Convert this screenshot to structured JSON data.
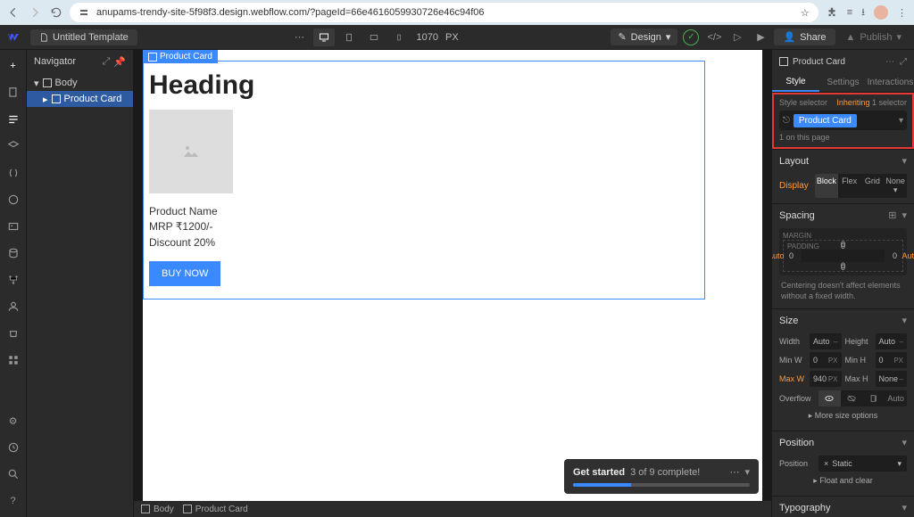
{
  "browser": {
    "url": "anupams-trendy-site-5f98f3.design.webflow.com/?pageId=66e4616059930726e46c94f06"
  },
  "appbar": {
    "doc_title": "Untitled Template",
    "breakpoint_width": "1070",
    "breakpoint_unit": "PX",
    "design_label": "Design",
    "share_label": "Share",
    "publish_label": "Publish"
  },
  "navigator": {
    "title": "Navigator",
    "items": [
      {
        "label": "Body"
      },
      {
        "label": "Product Card"
      }
    ]
  },
  "canvas": {
    "badge": "Product Card",
    "heading": "Heading",
    "lines": {
      "name": "Product Name",
      "mrp": "MRP ₹1200/-",
      "discount": "Discount 20%"
    },
    "buy": "BUY NOW"
  },
  "breadcrumbs": {
    "body": "Body",
    "card": "Product Card"
  },
  "toast": {
    "title": "Get started",
    "progress": "3 of 9 complete!",
    "percent": 33
  },
  "style": {
    "element": "Product Card",
    "tabs": {
      "style": "Style",
      "settings": "Settings",
      "interactions": "Interactions"
    },
    "selector": {
      "label": "Style selector",
      "inheriting": "Inheriting",
      "inherit_count": "1 selector",
      "class": "Product Card",
      "count": "1 on this page"
    },
    "layout": {
      "title": "Layout",
      "display": "Display",
      "opts": {
        "block": "Block",
        "flex": "Flex",
        "grid": "Grid",
        "none": "None"
      }
    },
    "spacing": {
      "title": "Spacing",
      "margin_label": "MARGIN",
      "padding_label": "PADDING",
      "top": "0",
      "right": "Auto",
      "bottom": "0",
      "left": "Auto",
      "p_top": "0",
      "p_right": "0",
      "p_bottom": "0",
      "p_left": "0",
      "note": "Centering doesn't affect elements without a fixed width."
    },
    "size": {
      "title": "Size",
      "width": "Width",
      "width_v": "Auto",
      "height": "Height",
      "height_v": "Auto",
      "minw": "Min W",
      "minw_v": "0",
      "minh": "Min H",
      "minh_v": "0",
      "maxw": "Max W",
      "maxw_v": "940",
      "maxh": "Max H",
      "maxh_v": "None",
      "overflow": "Overflow",
      "auto": "Auto",
      "more": "More size options"
    },
    "position": {
      "title": "Position",
      "label": "Position",
      "value": "Static",
      "float": "Float and clear"
    },
    "typography": {
      "title": "Typography"
    }
  }
}
